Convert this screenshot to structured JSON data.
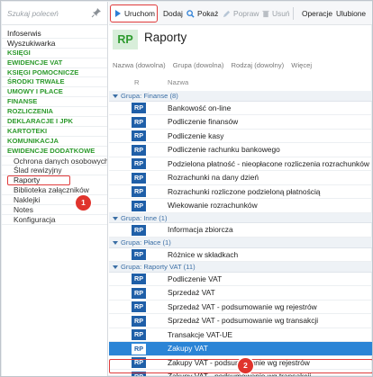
{
  "sidebar": {
    "search_placeholder": "Szukaj poleceń",
    "items": [
      {
        "label": "Infoserwis",
        "style": "plain"
      },
      {
        "label": "Wyszukiwarka",
        "style": "plain"
      },
      {
        "label": "KSIĘGI",
        "style": "green"
      },
      {
        "label": "EWIDENCJE VAT",
        "style": "green"
      },
      {
        "label": "KSIĘGI POMOCNICZE",
        "style": "green"
      },
      {
        "label": "ŚRODKI TRWAŁE",
        "style": "green"
      },
      {
        "label": "UMOWY I PŁACE",
        "style": "green"
      },
      {
        "label": "FINANSE",
        "style": "green"
      },
      {
        "label": "ROZLICZENIA",
        "style": "green"
      },
      {
        "label": "DEKLARACJE I JPK",
        "style": "green"
      },
      {
        "label": "KARTOTEKI",
        "style": "green"
      },
      {
        "label": "KOMUNIKACJA",
        "style": "green"
      },
      {
        "label": "EWIDENCJE DODATKOWE",
        "style": "green"
      },
      {
        "label": "Ochrona danych osobowych",
        "style": "sub"
      },
      {
        "label": "Ślad rewizyjny",
        "style": "sub"
      },
      {
        "label": "Raporty",
        "style": "active"
      },
      {
        "label": "Biblioteka załączników",
        "style": "sub"
      },
      {
        "label": "Naklejki",
        "style": "sub"
      },
      {
        "label": "Notes",
        "style": "sub"
      },
      {
        "label": "Konfiguracja",
        "style": "sub"
      }
    ]
  },
  "toolbar": {
    "run_label": "Uruchom",
    "add_label": "Dodaj",
    "show_label": "Pokaż",
    "edit_label": "Popraw",
    "delete_label": "Usuń",
    "operations_label": "Operacje",
    "favorites_label": "Ulubione"
  },
  "header": {
    "logo": "RP",
    "title": "Raporty"
  },
  "filters": [
    "Nazwa (dowolna)",
    "Grupa (dowolna)",
    "Rodzaj (dowolny)",
    "Więcej"
  ],
  "columns": {
    "r": "R",
    "name": "Nazwa"
  },
  "groups": [
    {
      "label": "Grupa: Finanse",
      "count": "(8)",
      "rows": [
        "Bankowość on-line",
        "Podliczenie finansów",
        "Podliczenie kasy",
        "Podliczenie rachunku bankowego",
        "Podzielona płatność - nieopłacone rozliczenia rozrachunków",
        "Rozrachunki na dany dzień",
        "Rozrachunki rozliczone podzieloną płatnością",
        "Wiekowanie rozrachunków"
      ]
    },
    {
      "label": "Grupa: Inne",
      "count": "(1)",
      "rows": [
        "Informacja zbiorcza"
      ]
    },
    {
      "label": "Grupa: Płace",
      "count": "(1)",
      "rows": [
        "Różnice w składkach"
      ]
    },
    {
      "label": "Grupa: Raporty VAT",
      "count": "(11)",
      "rows": [
        "Podliczenie VAT",
        "Sprzedaż VAT",
        "Sprzedaż VAT - podsumowanie wg rejestrów",
        "Sprzedaż VAT - podsumowanie wg transakcji",
        "Transakcje VAT-UE",
        "Zakupy VAT",
        "Zakupy VAT - podsumowanie wg rejestrów",
        "Zakupy VAT - podsumowanie wg transakcji"
      ]
    }
  ],
  "row_badge": "RP",
  "selected_row": "Zakupy VAT",
  "callouts": {
    "first": "1",
    "second": "2"
  },
  "colors": {
    "accent_green": "#2d9a2d",
    "selection_blue": "#2b84d6",
    "rp_icon_blue": "#1f5fa8",
    "callout_red": "#e0342d"
  }
}
